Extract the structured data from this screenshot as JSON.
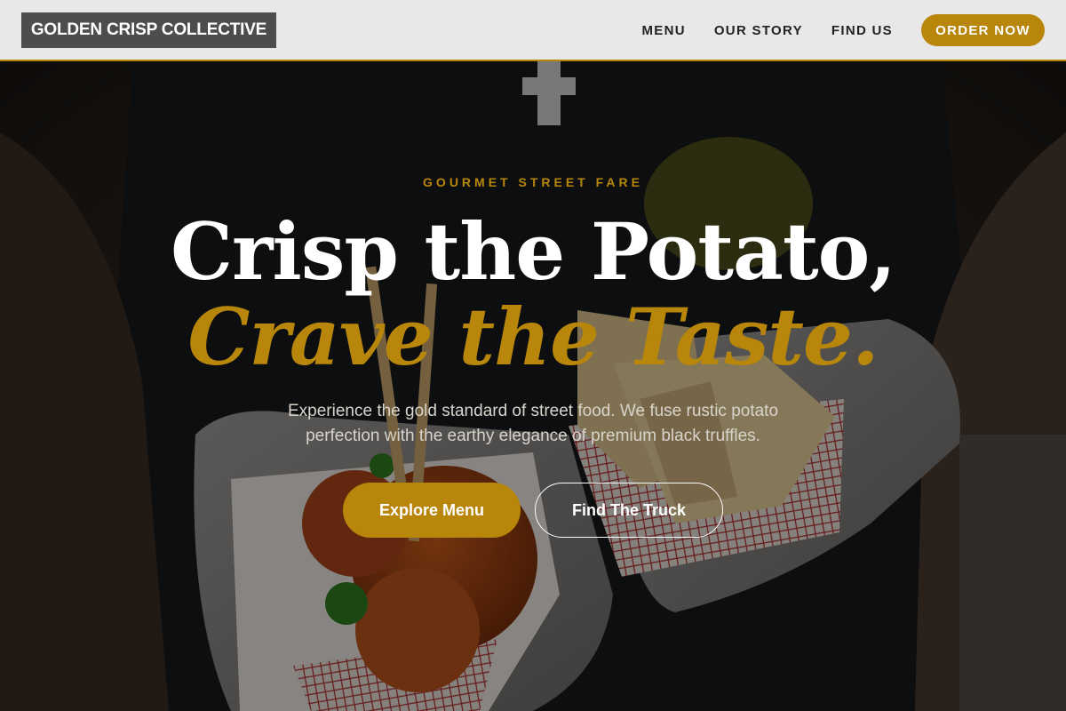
{
  "brand": {
    "name": "GOLDEN CRISP COLLECTIVE"
  },
  "nav": {
    "items": [
      {
        "label": "MENU"
      },
      {
        "label": "OUR STORY"
      },
      {
        "label": "FIND US"
      }
    ],
    "cta_label": "ORDER NOW"
  },
  "hero": {
    "eyebrow": "GOURMET STREET FARE",
    "headline_line1": "Crisp the Potato,",
    "headline_line2": "Crave the Taste.",
    "subtext": "Experience the gold standard of street food. We fuse rustic potato perfection with the earthy elegance of premium black truffles.",
    "primary_button": "Explore Menu",
    "secondary_button": "Find The Truck",
    "background_image": "street-food-photo"
  },
  "colors": {
    "accent": "#b8860b",
    "header_bg": "#e8e8e8",
    "logo_bg": "#4d4d4d",
    "overlay": "rgba(0,0,0,0.42)"
  }
}
